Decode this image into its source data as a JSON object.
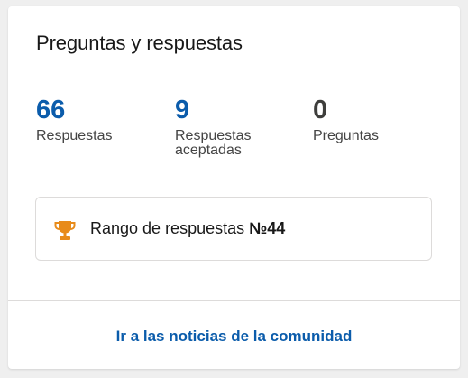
{
  "card": {
    "title": "Preguntas y respuestas"
  },
  "stats": [
    {
      "value": "66",
      "label": "Respuestas",
      "color": "#0b5cab"
    },
    {
      "value": "9",
      "label": "Respuestas aceptadas",
      "color": "#0b5cab"
    },
    {
      "value": "0",
      "label": "Preguntas",
      "color": "#3e3e3c"
    }
  ],
  "rank": {
    "icon": "trophy-icon",
    "label": "Rango de respuestas",
    "number": "№44",
    "icon_color": "#e88b1a"
  },
  "footer": {
    "link_label": "Ir a las noticias de la comunidad",
    "link_color": "#0b5cab"
  }
}
